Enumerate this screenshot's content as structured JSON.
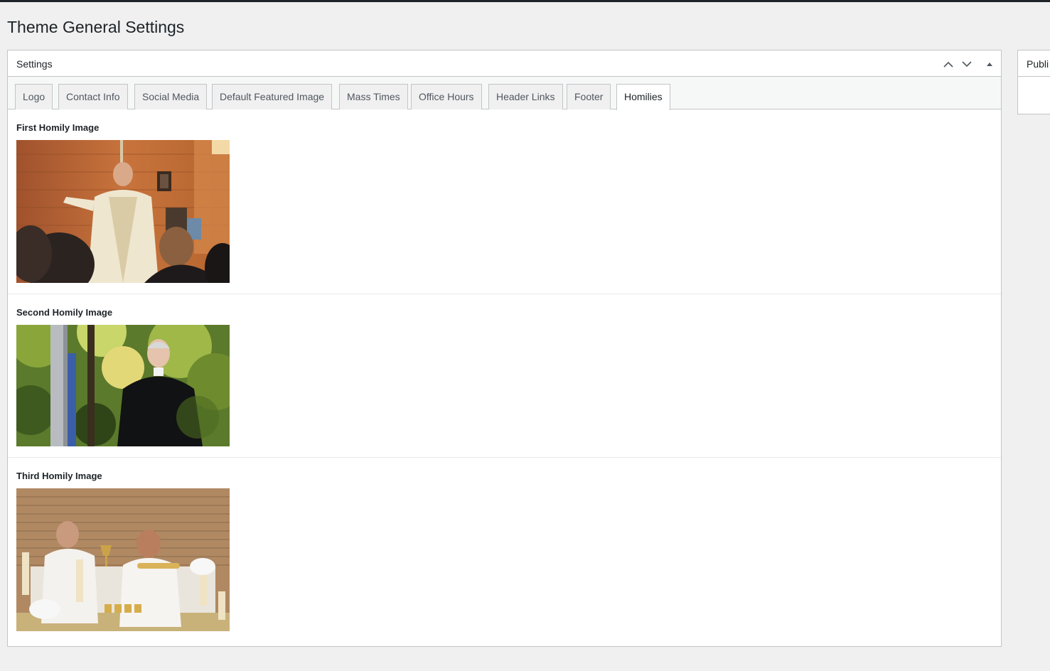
{
  "page": {
    "title": "Theme General Settings"
  },
  "settings_box": {
    "title": "Settings",
    "controls": [
      "move-up",
      "move-down",
      "toggle-panel"
    ]
  },
  "tabs": [
    {
      "label": "Logo",
      "active": false
    },
    {
      "label": "Contact Info",
      "active": false
    },
    {
      "label": "Social Media",
      "active": false
    },
    {
      "label": "Default Featured Image",
      "active": false
    },
    {
      "label": "Mass Times",
      "active": false
    },
    {
      "label": "Office Hours",
      "active": false
    },
    {
      "label": "Header Links",
      "active": false
    },
    {
      "label": "Footer",
      "active": false
    },
    {
      "label": "Homilies",
      "active": true
    }
  ],
  "fields": [
    {
      "label": "First Homily Image",
      "image": "priest-preaching-photo"
    },
    {
      "label": "Second Homily Image",
      "image": "priest-outdoors-photo"
    },
    {
      "label": "Third Homily Image",
      "image": "priests-at-altar-photo"
    }
  ],
  "side_box": {
    "title": "Publi"
  },
  "colors": {
    "background": "#f0f0f1",
    "border": "#c3c4c7",
    "text": "#1d2327",
    "tab_bg": "#f0f0f1"
  }
}
